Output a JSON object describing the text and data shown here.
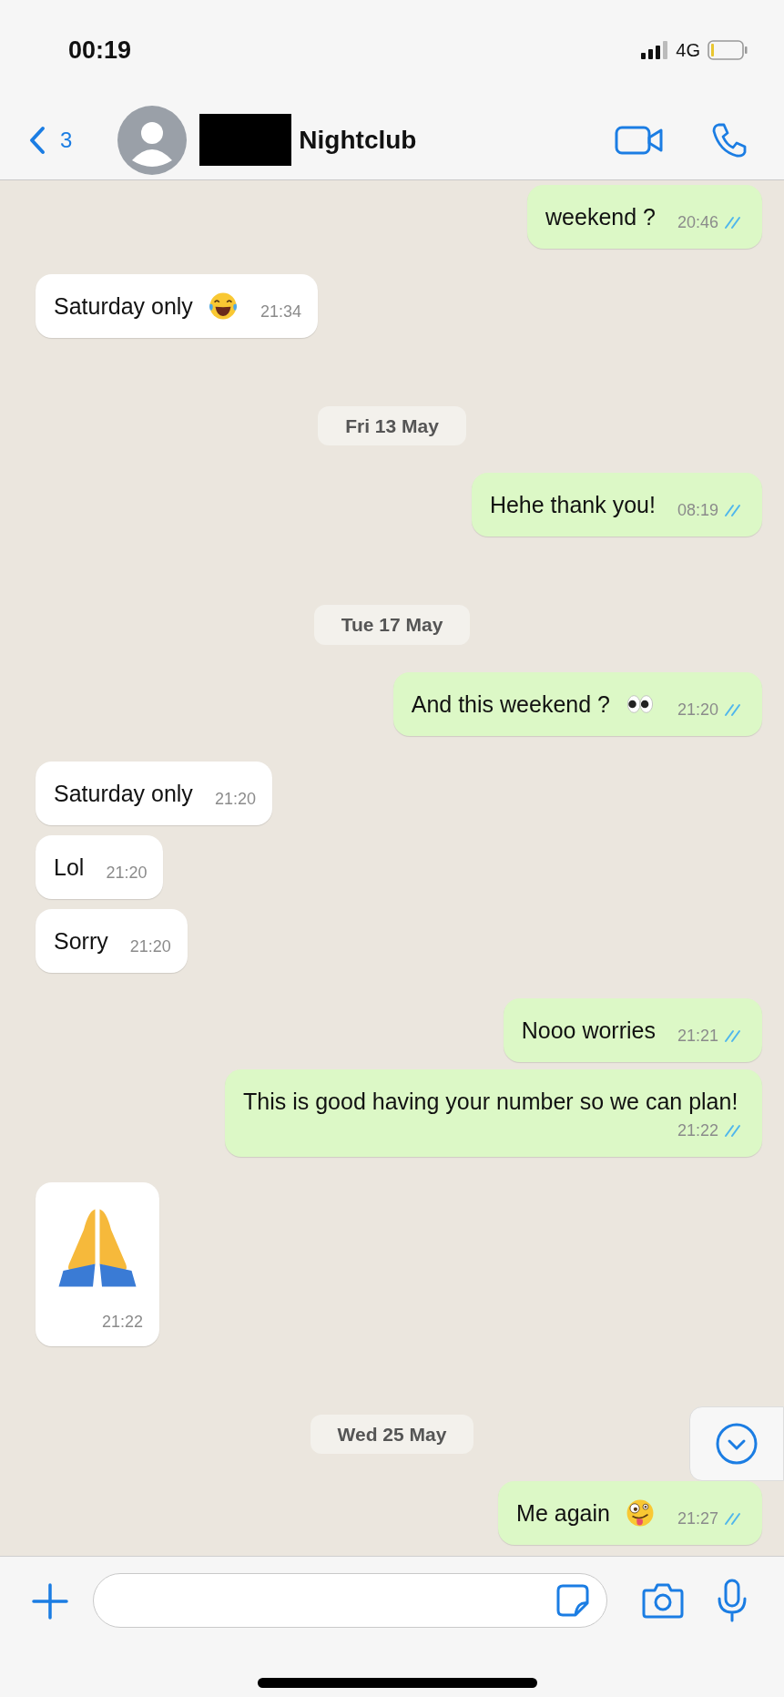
{
  "status_bar": {
    "time": "00:19",
    "network": "4G"
  },
  "header": {
    "back_count": "3",
    "contact_name": "Nightclub"
  },
  "messages": [
    {
      "kind": "outgoing",
      "text": "weekend ?",
      "time": "20:46",
      "read": true
    },
    {
      "kind": "incoming",
      "text": "Saturday only",
      "emoji": {
        "kind": "laughing"
      },
      "time": "21:34"
    },
    {
      "kind": "date",
      "text": "Fri 13 May"
    },
    {
      "kind": "outgoing",
      "text": "Hehe thank you!",
      "time": "08:19",
      "read": true
    },
    {
      "kind": "date",
      "text": "Tue 17 May"
    },
    {
      "kind": "outgoing",
      "text": "And this weekend ?",
      "emoji": {
        "kind": "eyes"
      },
      "time": "21:20",
      "read": true
    },
    {
      "kind": "incoming",
      "text": "Saturday only",
      "time": "21:20"
    },
    {
      "kind": "incoming",
      "text": "Lol",
      "time": "21:20"
    },
    {
      "kind": "incoming",
      "text": "Sorry",
      "time": "21:20"
    },
    {
      "kind": "outgoing",
      "text": "Nooo worries",
      "time": "21:21",
      "read": true
    },
    {
      "kind": "outgoing",
      "text": "This is good having your number so we can plan!",
      "time": "21:22",
      "read": true
    },
    {
      "kind": "incoming",
      "emoji": {
        "kind": "praying"
      },
      "time": "21:22"
    },
    {
      "kind": "date",
      "text": "Wed 25 May"
    },
    {
      "kind": "outgoing",
      "text": "Me again",
      "emoji": {
        "kind": "zany"
      },
      "time": "21:27",
      "read": true
    }
  ]
}
